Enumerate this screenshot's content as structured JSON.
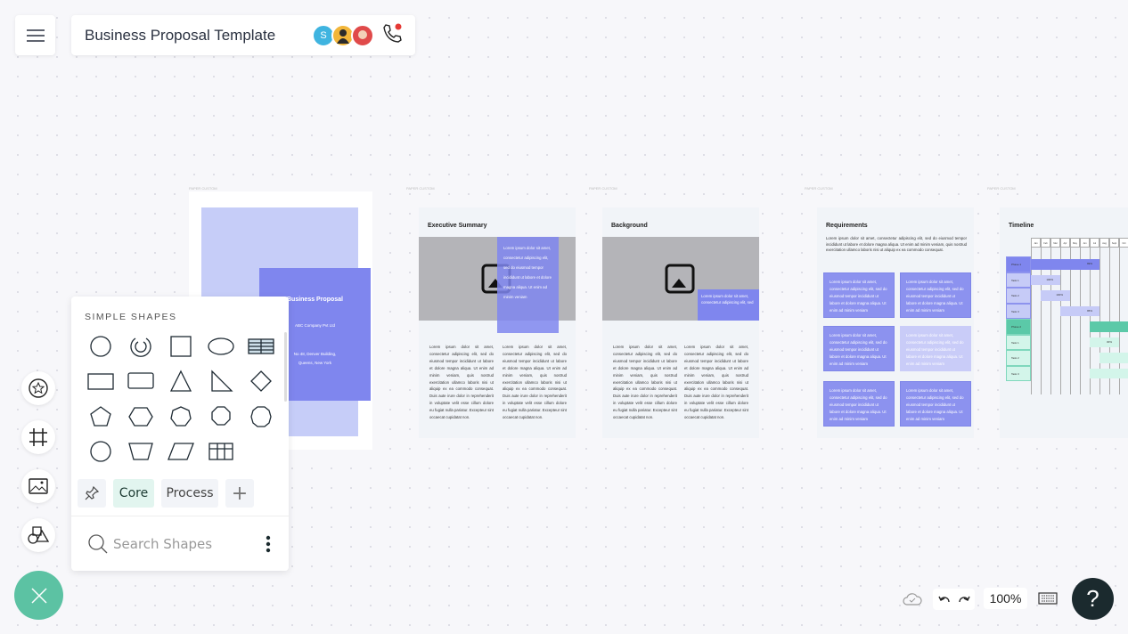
{
  "header": {
    "menu_icon": "hamburger-icon",
    "title": "Business Proposal Template",
    "collaborators": [
      {
        "initial": "S",
        "color": "#3fb4e0"
      },
      {
        "initial": "",
        "color": "#f2b63a"
      },
      {
        "initial": "",
        "color": "#e04a4a"
      }
    ],
    "call_icon": "phone-icon",
    "call_indicator_color": "#e53935"
  },
  "pages": {
    "label": "PAPER  CUSTOM",
    "cover": {
      "title": "Business Proposal",
      "company": "ABC Company Pvt Ltd",
      "address1": "No 48, Denver Building,",
      "address2": "Queens, New York"
    },
    "executive": {
      "title": "Executive Summary",
      "overlay": "Lorem ipsum dolor sit amet, consectetur adipiscing elit, sed do eiusmod tempor incididunt ut labore et dolore magna aliqua. Ut enim ad minim veniam",
      "col": "Lorem ipsum dolor sit amet, consectetur adipiscing elit, sed do eiusmod tempor incididunt ut labore et dolore magna aliqua. Ut enim ad minim veniam, quis nostrud exercitation ullamco laboris nisi ut aliquip ex ea commodo consequat. Duis aute irure dolor in reprehenderit in voluptate velit esse cillum dolore eu fugiat nulla pariatur. Excepteur sint occaecat cupidatat non."
    },
    "background": {
      "title": "Background",
      "overlay": "Lorem ipsum dolor sit amet, consectetur adipiscing elit, sed",
      "col": "Lorem ipsum dolor sit amet, consectetur adipiscing elit, sed do eiusmod tempor incididunt ut labore et dolore magna aliqua. Ut enim ad minim veniam, quis nostrud exercitation ullamco laboris nisi ut aliquip ex ea commodo consequat. Duis aute irure dolor in reprehenderit in voluptate velit esse cillum dolore eu fugiat nulla pariatur. Excepteur sint occaecat cupidatat non."
    },
    "requirements": {
      "title": "Requirements",
      "intro": "Lorem ipsum dolor sit amet, consectetur adipiscing elit, sed do eiusmod tempor incididunt ut labore et dolore magna aliqua. Ut enim ad minim veniam, quis nostrud exercitation ullamco laboris nisi ut aliquip ex ea commodo consequat.",
      "box": "Lorem ipsum dolor sit amet, consectetur adipiscing elit, sed do eiusmod tempor incididunt ut labore et dolore magna aliqua. Ut enim ad minim veniam"
    },
    "timeline": {
      "title": "Timeline",
      "months": [
        "Jan",
        "Feb",
        "Mar",
        "Apr",
        "May",
        "Jun",
        "Jul",
        "Aug",
        "Sept",
        "Oct"
      ],
      "rows": [
        {
          "label": "Phase 1",
          "start": 0,
          "end": 7,
          "pct": "99%",
          "group": 1,
          "phase": true
        },
        {
          "label": "Task 1",
          "start": 0,
          "end": 3,
          "pct": "100%",
          "group": 1
        },
        {
          "label": "Task 2",
          "start": 1,
          "end": 4,
          "pct": "100%",
          "group": 1
        },
        {
          "label": "Task 3",
          "start": 3,
          "end": 7,
          "pct": "95%",
          "group": 1
        },
        {
          "label": "Phase 2",
          "start": 6,
          "end": 10,
          "pct": "",
          "group": 2,
          "phase": true
        },
        {
          "label": "Task 1",
          "start": 6,
          "end": 9,
          "pct": "30%",
          "group": 2
        },
        {
          "label": "Task 2",
          "start": 7,
          "end": 10,
          "pct": "",
          "group": 2
        },
        {
          "label": "Task 3",
          "start": 6,
          "end": 10,
          "pct": "",
          "group": 2
        }
      ]
    }
  },
  "shapes_panel": {
    "heading": "SIMPLE SHAPES",
    "shapes": [
      "circle",
      "arc",
      "square",
      "ellipse",
      "table-striped",
      "rectangle",
      "rounded-rectangle",
      "triangle",
      "right-triangle",
      "diamond",
      "pentagon",
      "hexagon",
      "heptagon",
      "octagon",
      "decagon",
      "dodecagon",
      "trapezoid",
      "parallelogram",
      "table"
    ],
    "tabs": {
      "pin_icon": "pin-icon",
      "core": "Core",
      "process": "Process",
      "add_icon": "plus-icon"
    },
    "search_placeholder": "Search Shapes",
    "more_icon": "more-vertical-icon"
  },
  "left_tools": [
    "sticker-icon",
    "frame-icon",
    "image-icon",
    "shapes-icon"
  ],
  "bottom": {
    "zoom": "100%",
    "help": "?"
  },
  "colors": {
    "accent": "#5cc2a3",
    "purple": "#7f86ee",
    "light_purple": "#c6cdf8",
    "teal": "#5bc9a8"
  }
}
